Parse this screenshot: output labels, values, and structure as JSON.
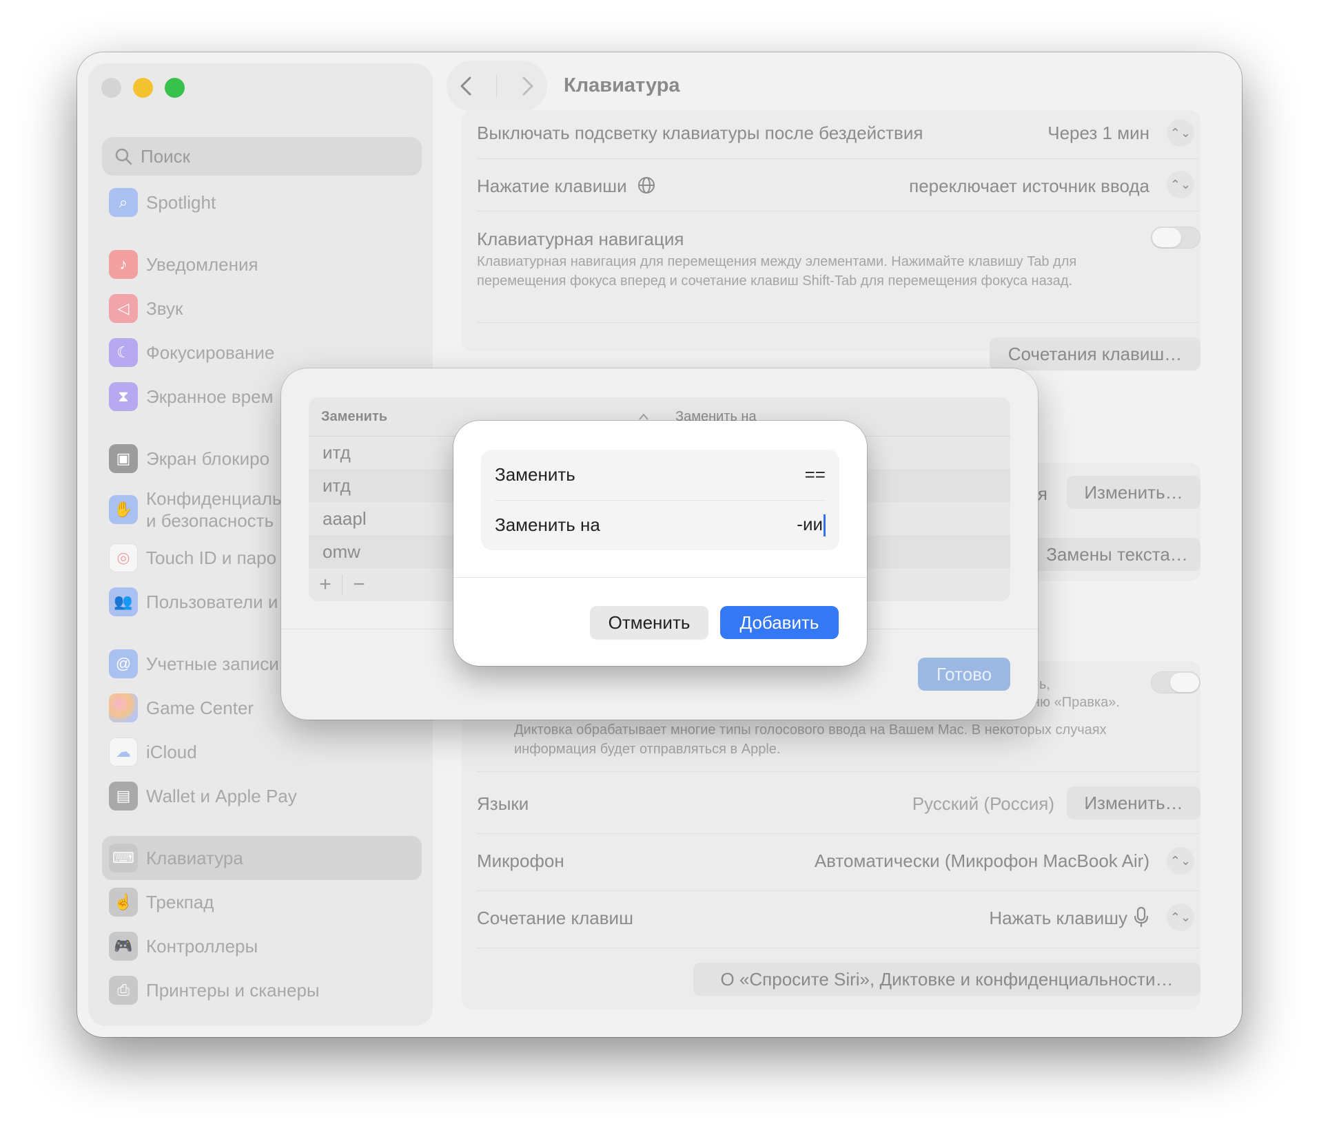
{
  "window": {
    "title": "Клавиатура"
  },
  "sidebar": {
    "search_placeholder": "Поиск",
    "items": [
      {
        "label": "Spotlight",
        "icon": "magnifier-icon",
        "color": "#9db7ef"
      },
      {
        "label": "Уведомления",
        "icon": "bell-icon",
        "color": "#f19a9a"
      },
      {
        "label": "Звук",
        "icon": "speaker-icon",
        "color": "#f2a1a9"
      },
      {
        "label": "Фокусирование",
        "icon": "moon-icon",
        "color": "#b5a6ef"
      },
      {
        "label": "Экранное врем",
        "icon": "hourglass-icon",
        "color": "#b5a6ef"
      },
      {
        "label": "Экран блокиро",
        "icon": "lock-icon",
        "color": "#9a9a9a"
      },
      {
        "label": "Конфиденциаль",
        "label2": "и безопасность",
        "icon": "hand-icon",
        "color": "#9db7ef"
      },
      {
        "label": "Touch ID и паро",
        "icon": "fingerprint-icon",
        "color": "#f4f4f4"
      },
      {
        "label": "Пользователи и",
        "icon": "users-icon",
        "color": "#9db7ef"
      },
      {
        "label": "Учетные записи",
        "icon": "at-icon",
        "color": "#9db7ef"
      },
      {
        "label": "Game Center",
        "icon": "game-center-icon",
        "color": "#f4c2c2"
      },
      {
        "label": "iCloud",
        "icon": "cloud-icon",
        "color": "#f4f4f4"
      },
      {
        "label": "Wallet и Apple Pay",
        "icon": "wallet-icon",
        "color": "#a7a7a7"
      },
      {
        "label": "Клавиатура",
        "icon": "keyboard-icon",
        "color": "#c5c5c5"
      },
      {
        "label": "Трекпад",
        "icon": "trackpad-icon",
        "color": "#c5c5c5"
      },
      {
        "label": "Контроллеры",
        "icon": "gamepad-icon",
        "color": "#c5c5c5"
      },
      {
        "label": "Принтеры и сканеры",
        "icon": "printer-icon",
        "color": "#c5c5c5"
      }
    ]
  },
  "settings": {
    "backlight_label": "Выключать подсветку клавиатуры после бездействия",
    "backlight_value": "Через 1 мин",
    "key_press_label": "Нажатие клавиши",
    "key_press_value": "переключает источник ввода",
    "kbd_nav_label": "Клавиатурная навигация",
    "kbd_nav_desc": "Клавиатурная навигация для перемещения между элементами. Нажимайте клавишу Tab для перемещения фокуса вперед и сочетание клавиш Shift-Tab для перемещения фокуса назад.",
    "shortcuts_button": "Сочетания клавиш…",
    "input_partial": "ая",
    "change_button": "Изменить…",
    "text_replacements_button": "Замены текста…",
    "dictation_partial1": "ь,",
    "dictation_partial2": "ню «Правка».",
    "dictation_desc": "Диктовка обрабатывает многие типы голосового ввода на Вашем Mac. В некоторых случаях информация будет отправляться в Apple.",
    "languages_label": "Языки",
    "languages_value": "Русский (Россия)",
    "languages_button": "Изменить…",
    "mic_label": "Микрофон",
    "mic_value": "Автоматически (Микрофон MacBook Air)",
    "shortcut_label": "Сочетание клавиш",
    "shortcut_value": "Нажать клавишу",
    "siri_button": "О «Спросите Siri», Диктовке и конфиденциальности…"
  },
  "sheet": {
    "col_replace": "Заменить",
    "col_with": "Заменить на",
    "rows": [
      "итд",
      "итд",
      "aaapl",
      "omw"
    ],
    "done_button": "Готово"
  },
  "dialog": {
    "replace_label": "Заменить",
    "replace_value": "==",
    "with_label": "Заменить на",
    "with_value": "-ии",
    "cancel_button": "Отменить",
    "add_button": "Добавить"
  }
}
